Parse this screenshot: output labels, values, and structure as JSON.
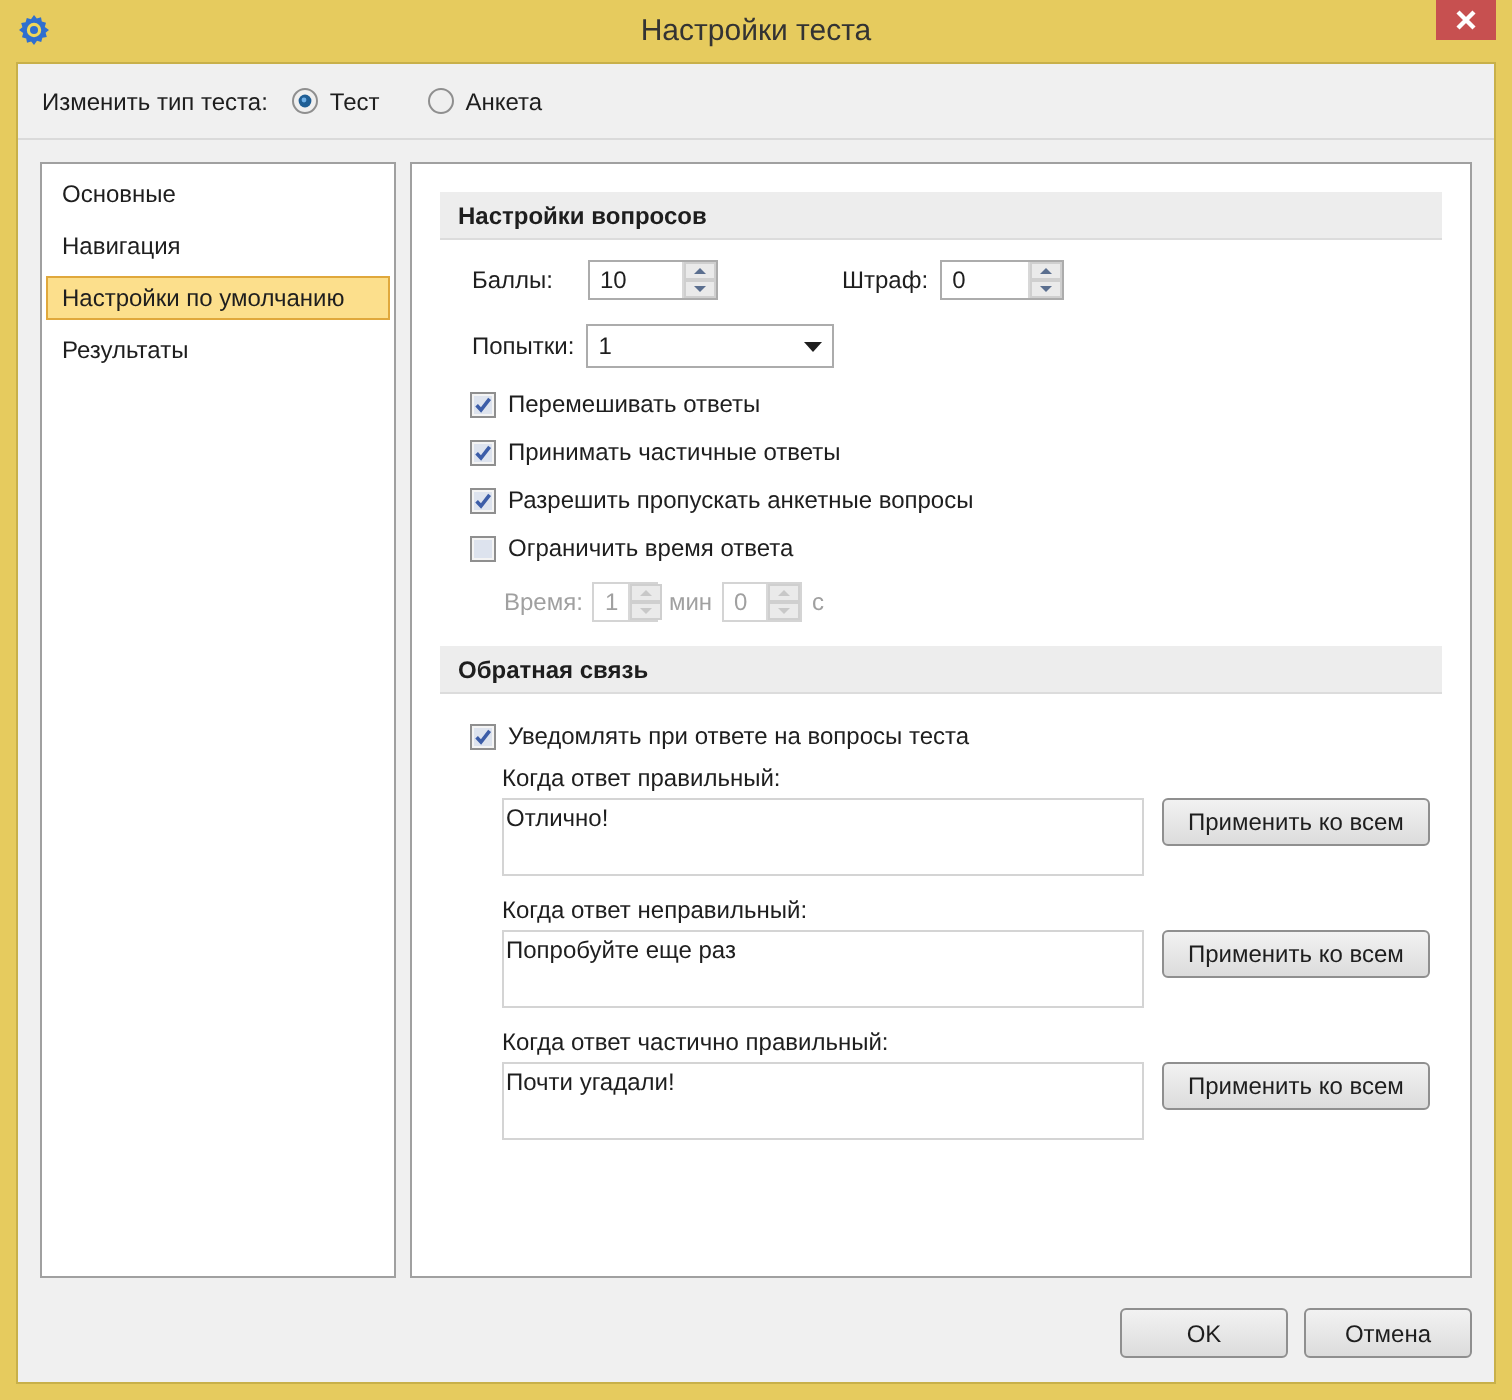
{
  "window": {
    "title": "Настройки теста"
  },
  "test_type": {
    "label": "Изменить тип теста:",
    "options": [
      {
        "label": "Тест",
        "selected": true
      },
      {
        "label": "Анкета",
        "selected": false
      }
    ]
  },
  "sidebar": {
    "items": [
      {
        "label": "Основные",
        "selected": false
      },
      {
        "label": "Навигация",
        "selected": false
      },
      {
        "label": "Настройки по умолчанию",
        "selected": true
      },
      {
        "label": "Результаты",
        "selected": false
      }
    ]
  },
  "question_settings": {
    "title": "Настройки вопросов",
    "points": {
      "label": "Баллы:",
      "value": "10"
    },
    "penalty": {
      "label": "Штраф:",
      "value": "0"
    },
    "attempts": {
      "label": "Попытки:",
      "value": "1"
    },
    "checkboxes": [
      {
        "label": "Перемешивать ответы",
        "checked": true
      },
      {
        "label": "Принимать частичные ответы",
        "checked": true
      },
      {
        "label": "Разрешить пропускать анкетные вопросы",
        "checked": true
      },
      {
        "label": "Ограничить время ответа",
        "checked": false
      }
    ],
    "time": {
      "label": "Время:",
      "minutes": "1",
      "minutes_unit": "мин",
      "seconds": "0",
      "seconds_unit": "с",
      "disabled": true
    }
  },
  "feedback": {
    "title": "Обратная связь",
    "notify": {
      "label": "Уведомлять при ответе на вопросы теста",
      "checked": true
    },
    "messages": [
      {
        "label": "Когда ответ правильный:",
        "value": "Отлично!",
        "button": "Применить ко всем"
      },
      {
        "label": "Когда ответ неправильный:",
        "value": "Попробуйте еще раз",
        "button": "Применить ко всем"
      },
      {
        "label": "Когда ответ частично правильный:",
        "value": "Почти угадали!",
        "button": "Применить ко всем"
      }
    ]
  },
  "buttons": [
    {
      "label": "OK"
    },
    {
      "label": "Отмена"
    }
  ]
}
